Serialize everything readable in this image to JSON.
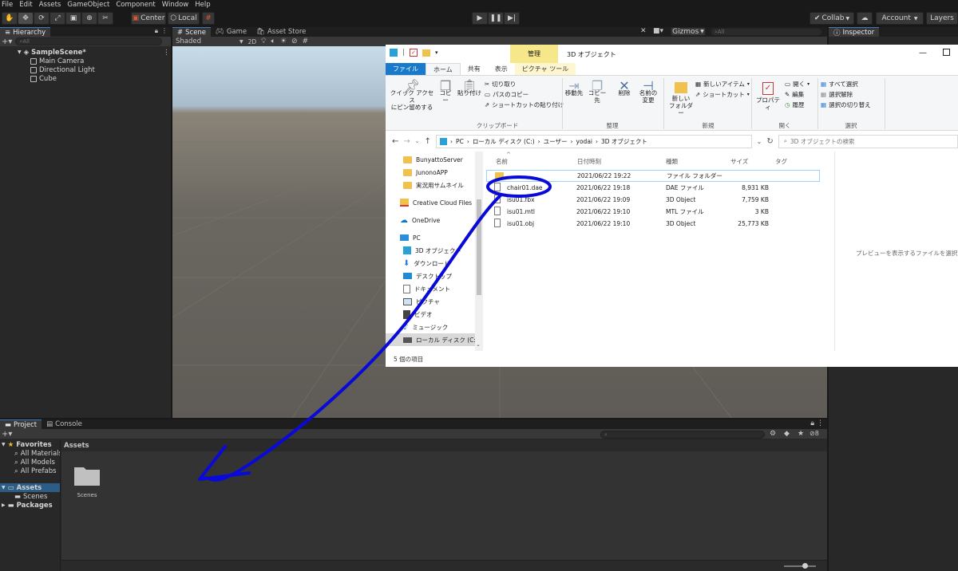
{
  "menubar": [
    "File",
    "Edit",
    "Assets",
    "GameObject",
    "Component",
    "Window",
    "Help"
  ],
  "toolbar": {
    "center": "Center",
    "local": "Local",
    "collab": "Collab",
    "account": "Account",
    "layers": "Layers"
  },
  "hierarchy": {
    "tab": "Hierarchy",
    "search_placeholder": "All",
    "scene": "SampleScene*",
    "items": [
      "Main Camera",
      "Directional Light",
      "Cube"
    ]
  },
  "scene_view": {
    "tabs": [
      "Scene",
      "Game",
      "Asset Store"
    ],
    "shading": "Shaded",
    "mode_2d": "2D",
    "gizmos": "Gizmos",
    "search_placeholder": "All"
  },
  "inspector": {
    "tab": "Inspector"
  },
  "project": {
    "tabs": [
      "Project",
      "Console"
    ],
    "favorites_label": "Favorites",
    "favorites": [
      "All Materials",
      "All Models",
      "All Prefabs"
    ],
    "assets_label": "Assets",
    "assets_children": [
      "Scenes"
    ],
    "packages_label": "Packages",
    "breadcrumb": "Assets",
    "folder": "Scenes",
    "hidden_count": "8"
  },
  "explorer": {
    "title": "3D オブジェクト",
    "manage_tab": "管理",
    "ribbon_tabs": [
      "ファイル",
      "ホーム",
      "共有",
      "表示",
      "ピクチャ ツール"
    ],
    "clipboard": {
      "pin": "クイック アクセス\nにピン留めする",
      "copy": "コピー",
      "paste": "貼り付け",
      "cut": "切り取り",
      "copy_path": "パスのコピー",
      "paste_shortcut": "ショートカットの貼り付け",
      "label": "クリップボード"
    },
    "organize": {
      "move": "移動先",
      "copy_to": "コピー先",
      "delete": "削除",
      "rename": "名前の\n変更",
      "label": "整理"
    },
    "new": {
      "new_folder": "新しい\nフォルダー",
      "new_item": "新しいアイテム",
      "shortcut": "ショートカット",
      "label": "新規"
    },
    "open": {
      "properties": "プロパティ",
      "open": "開く",
      "edit": "編集",
      "history": "履歴",
      "label": "開く"
    },
    "select": {
      "all": "すべて選択",
      "none": "選択解除",
      "invert": "選択の切り替え",
      "label": "選択"
    },
    "path": [
      "PC",
      "ローカル ディスク (C:)",
      "ユーザー",
      "yodai",
      "3D オブジェクト"
    ],
    "search_placeholder": "3D オブジェクトの検索",
    "nav": [
      "BunyattoServer",
      "JunonoAPP",
      "実況用サムネイル",
      "Creative Cloud Files",
      "OneDrive",
      "PC",
      "3D オブジェクト",
      "ダウンロード",
      "デスクトップ",
      "ドキュメント",
      "ピクチャ",
      "ビデオ",
      "ミュージック",
      "ローカル ディスク (C:)"
    ],
    "columns": [
      "名前",
      "日付時刻",
      "種類",
      "サイズ",
      "タグ"
    ],
    "files": [
      {
        "name": "",
        "date": "2021/06/22 19:22",
        "type": "ファイル フォルダー",
        "size": ""
      },
      {
        "name": "chair01.dae",
        "date": "2021/06/22 19:18",
        "type": "DAE ファイル",
        "size": "8,931 KB"
      },
      {
        "name": "isu01.fbx",
        "date": "2021/06/22 19:09",
        "type": "3D Object",
        "size": "7,759 KB"
      },
      {
        "name": "isu01.mtl",
        "date": "2021/06/22 19:10",
        "type": "MTL ファイル",
        "size": "3 KB"
      },
      {
        "name": "isu01.obj",
        "date": "2021/06/22 19:10",
        "type": "3D Object",
        "size": "25,773 KB"
      }
    ],
    "preview_text": "プレビューを表示するファイルを選択します",
    "status": "5 個の項目"
  },
  "colors": {
    "unity_dark": "#282828",
    "annotation_blue": "#0a0ad8",
    "explorer_accent": "#0063b1"
  }
}
